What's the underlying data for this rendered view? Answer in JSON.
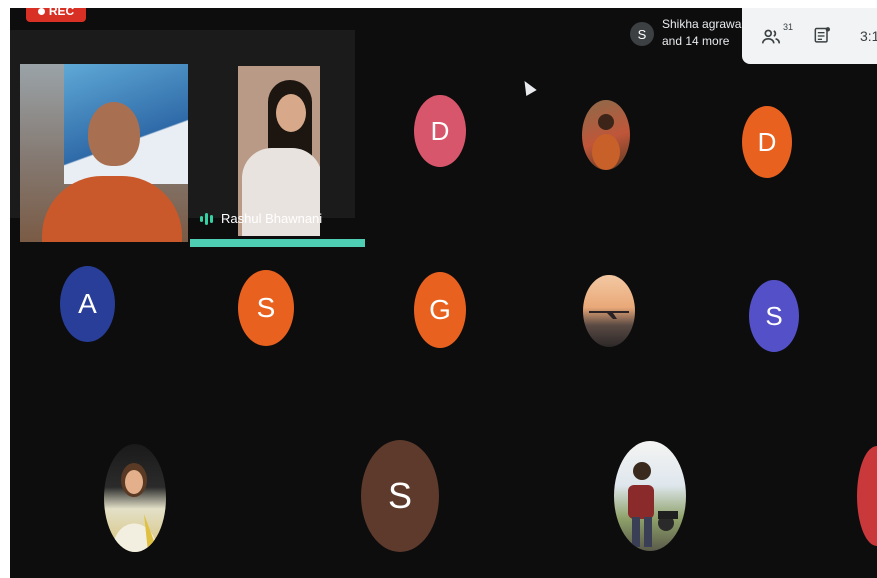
{
  "recording": {
    "label": "REC"
  },
  "presenter_tile": {
    "speaker_name": "Rashul Bhawnani"
  },
  "participants_chip": {
    "avatar_letter": "S",
    "line1": "Shikha agrawal",
    "line2": "and 14 more"
  },
  "toolbar": {
    "participants_count": "31",
    "time_partial": "3:1"
  },
  "colors": {
    "rec": "#d93025",
    "speaking": "#4ecfb3",
    "avatar_pink": "#d8566b",
    "avatar_orange": "#e8611f",
    "avatar_blue": "#283e98",
    "avatar_purple": "#5451c8",
    "avatar_brown": "#5e3a2c",
    "avatar_red": "#c9393c"
  },
  "grid": {
    "row1": [
      {
        "kind": "letter",
        "letter": "D",
        "color": "#d8566b"
      },
      {
        "kind": "photo",
        "icon": "person-photo"
      },
      {
        "kind": "letter",
        "letter": "D",
        "color": "#e8611f"
      }
    ],
    "row2": [
      {
        "kind": "letter",
        "letter": "A",
        "color": "#283e98"
      },
      {
        "kind": "letter",
        "letter": "S",
        "color": "#e8611f"
      },
      {
        "kind": "letter",
        "letter": "G",
        "color": "#e8611f"
      },
      {
        "kind": "photo",
        "icon": "airplane-photo"
      },
      {
        "kind": "letter",
        "letter": "S",
        "color": "#5451c8"
      }
    ],
    "row3": [
      {
        "kind": "photo",
        "icon": "person-photo"
      },
      {
        "kind": "letter",
        "letter": "S",
        "color": "#5e3a2c"
      },
      {
        "kind": "photo",
        "icon": "person-photo"
      },
      {
        "kind": "partial",
        "color": "#c9393c"
      }
    ]
  }
}
